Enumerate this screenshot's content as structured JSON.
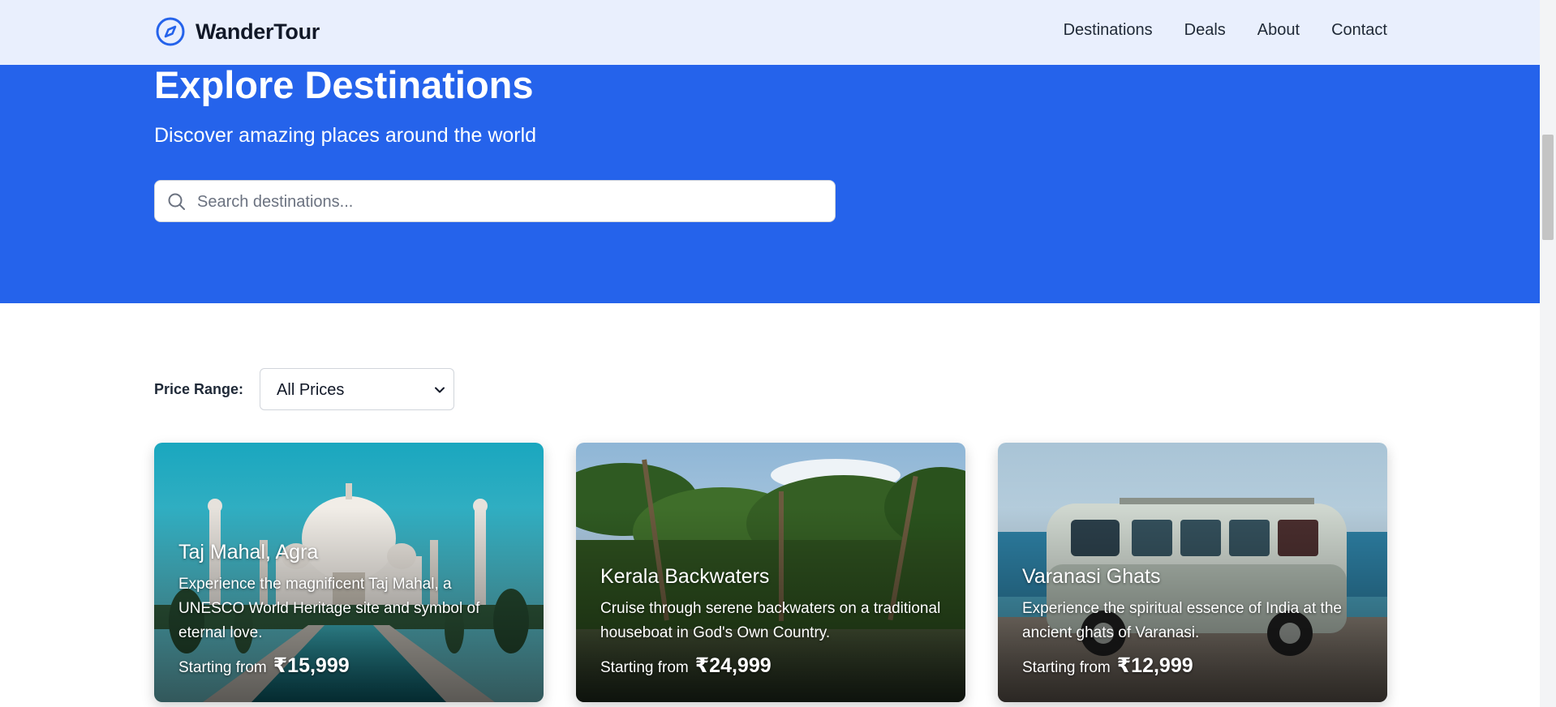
{
  "navbar": {
    "brand": "WanderTour",
    "links": [
      "Destinations",
      "Deals",
      "About",
      "Contact"
    ]
  },
  "hero": {
    "title": "Explore Destinations",
    "subtitle": "Discover amazing places around the world",
    "search_placeholder": "Search destinations...",
    "search_value": ""
  },
  "filter": {
    "label": "Price Range:",
    "selected": "All Prices"
  },
  "cards": [
    {
      "title": "Taj Mahal, Agra",
      "description": "Experience the magnificent Taj Mahal, a UNESCO World Heritage site and symbol of eternal love.",
      "price_label": "Starting from",
      "price": "₹15,999"
    },
    {
      "title": "Kerala Backwaters",
      "description": "Cruise through serene backwaters on a traditional houseboat in God's Own Country.",
      "price_label": "Starting from",
      "price": "₹24,999"
    },
    {
      "title": "Varanasi Ghats",
      "description": "Experience the spiritual essence of India at the ancient ghats of Varanasi.",
      "price_label": "Starting from",
      "price": "₹12,999"
    }
  ],
  "colors": {
    "primary": "#2563eb",
    "navbar_bg": "#e9effd",
    "text_dark": "#111827"
  },
  "icons": {
    "brand": "compass-icon",
    "search": "search-icon",
    "select": "chevron-down-icon"
  }
}
